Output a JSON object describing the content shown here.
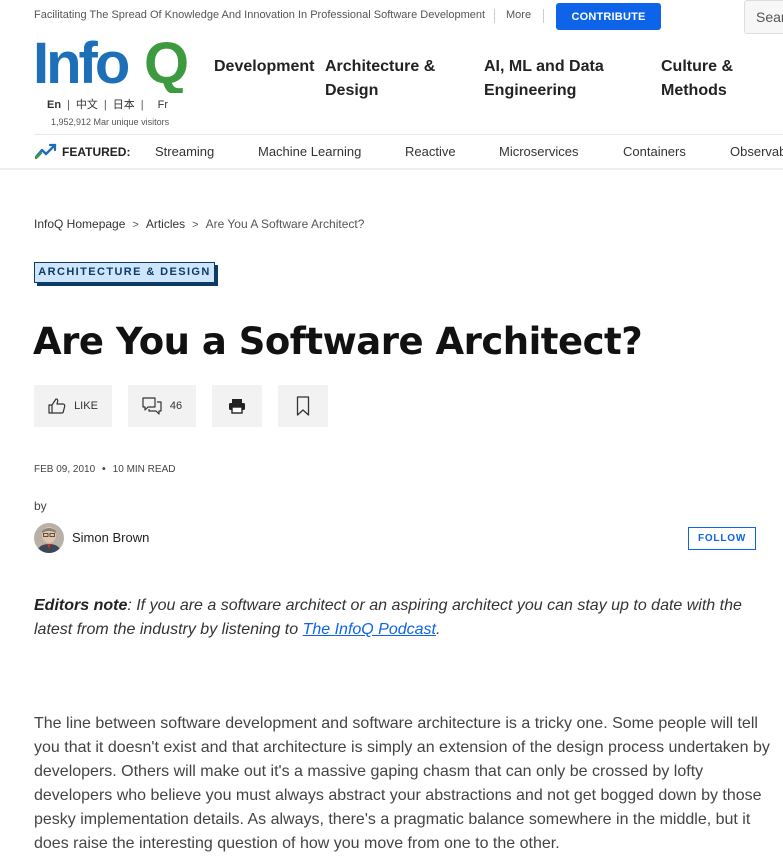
{
  "topbar": {
    "tagline": "Facilitating The Spread Of Knowledge And Innovation In Professional Software Development",
    "more_label": "More",
    "contribute_label": "CONTRIBUTE",
    "search_placeholder": "Search"
  },
  "brand": {
    "logo_text_left": "Info",
    "logo_text_right": "Q",
    "logo_blue": "#1d6fb8",
    "logo_green": "#3d9a3f",
    "languages": [
      "En",
      "中文",
      "日本",
      "Fr"
    ],
    "visitors": "1,952,912 Mar unique visitors"
  },
  "main_nav": [
    {
      "line1": "Development",
      "line2": ""
    },
    {
      "line1": "Architecture &",
      "line2": "Design"
    },
    {
      "line1": "AI, ML and Data",
      "line2": "Engineering"
    },
    {
      "line1": "Culture &",
      "line2": "Methods"
    }
  ],
  "featured": {
    "label": "FEATURED:",
    "items": [
      "Streaming",
      "Machine Learning",
      "Reactive",
      "Microservices",
      "Containers",
      "Observability"
    ]
  },
  "breadcrumb": {
    "items": [
      "InfoQ Homepage",
      "Articles",
      "Are You A Software Architect?"
    ],
    "separator": ">"
  },
  "article": {
    "topic_badge": "ARCHITECTURE & DESIGN",
    "title": "Are You a Software Architect?",
    "actions": {
      "like_label": "LIKE",
      "comment_count": "46"
    },
    "date": "FEB 09, 2010",
    "read_time": "10 MIN READ",
    "by_label": "by",
    "author": "Simon Brown",
    "follow_label": "FOLLOW",
    "note": {
      "label": "Editors note",
      "text": ": If you are a software architect or an aspiring architect you can stay up to date with the latest from the industry by listening to ",
      "link_text": "The InfoQ Podcast",
      "end": "."
    },
    "paragraph": "The line between software development and software architecture is a tricky one. Some people will tell you that it doesn't exist and that architecture is simply an extension of the design process undertaken by developers. Others will make out it's a massive gaping chasm that can only be crossed by lofty developers who believe you must always abstract your abstractions and not get bogged down by those pesky implementation details. As always, there's a pragmatic balance somewhere in the middle, but it does raise the interesting question of how you move from one to the other."
  },
  "colors": {
    "accent": "#0d64e8",
    "badge_bg": "#cfe5fb",
    "badge_border": "#0b3b66"
  },
  "icons": [
    "featured-trend-icon",
    "thumbs-up-icon",
    "comments-icon",
    "print-icon",
    "bookmark-icon"
  ]
}
